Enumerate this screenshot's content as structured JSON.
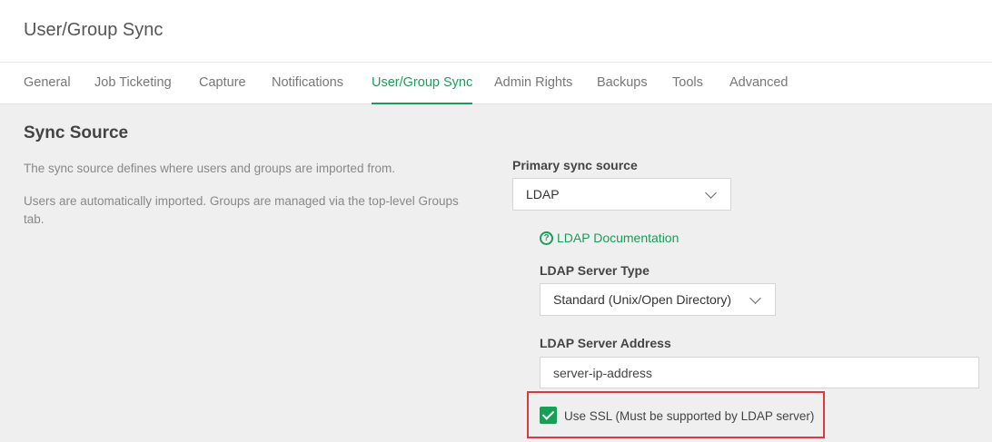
{
  "header": {
    "title": "User/Group Sync"
  },
  "tabs": [
    {
      "label": "General"
    },
    {
      "label": "Job Ticketing"
    },
    {
      "label": "Capture"
    },
    {
      "label": "Notifications"
    },
    {
      "label": "User/Group Sync"
    },
    {
      "label": "Admin Rights"
    },
    {
      "label": "Backups"
    },
    {
      "label": "Tools"
    },
    {
      "label": "Advanced"
    }
  ],
  "active_tab": "User/Group Sync",
  "section": {
    "title": "Sync Source",
    "desc1": "The sync source defines where users and groups are imported from.",
    "desc2": "Users are automatically imported. Groups are managed via the top-level Groups tab."
  },
  "form": {
    "primary_source_label": "Primary sync source",
    "primary_source_value": "LDAP",
    "doc_link": "LDAP Documentation",
    "server_type_label": "LDAP Server Type",
    "server_type_value": "Standard (Unix/Open Directory)",
    "server_address_label": "LDAP Server Address",
    "server_address_value": "server-ip-address",
    "ssl_label": "Use SSL (Must be supported by LDAP server)",
    "ssl_checked": true
  },
  "colors": {
    "accent": "#1a9e57",
    "highlight": "#e0363e"
  },
  "icons": {
    "doc": "help-circle-icon",
    "select": "chevron-down-icon",
    "checkbox": "checkmark-icon"
  }
}
